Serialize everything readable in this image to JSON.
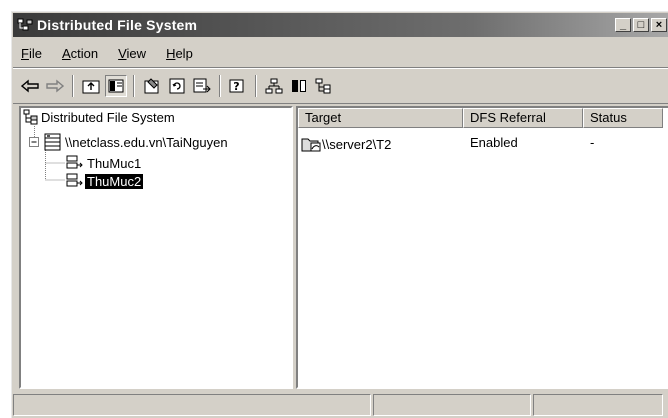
{
  "window": {
    "title": "Distributed File System",
    "caption_buttons": [
      "_",
      "□",
      "×"
    ]
  },
  "menu": {
    "items": [
      {
        "label": "File",
        "accel": "F",
        "rest": "ile"
      },
      {
        "label": "Action",
        "accel": "A",
        "rest": "ction"
      },
      {
        "label": "View",
        "accel": "V",
        "rest": "iew"
      },
      {
        "label": "Help",
        "accel": "H",
        "rest": "elp"
      }
    ]
  },
  "toolbar": {
    "icons": [
      "back-arrow-icon",
      "forward-arrow-icon",
      "up-folder-icon",
      "show-hide-tree-icon",
      "properties-icon",
      "refresh-icon",
      "export-list-icon",
      "help-icon",
      "new-root-icon",
      "columns-icon",
      "new-link-icon"
    ]
  },
  "tree": {
    "root": "Distributed File System",
    "dfs_root": "\\\\netclass.edu.vn\\TaiNguyen",
    "links": [
      "ThuMuc1",
      "ThuMuc2"
    ],
    "selected": "ThuMuc2"
  },
  "list": {
    "columns": [
      "Target",
      "DFS Referral",
      "Status"
    ],
    "rows": [
      {
        "target": "\\\\server2\\T2",
        "referral": "Enabled",
        "status": "-"
      }
    ]
  },
  "colors": {
    "titlebar_start": "#3a3a3a",
    "face": "#d4d0c8",
    "selection": "#000000"
  }
}
